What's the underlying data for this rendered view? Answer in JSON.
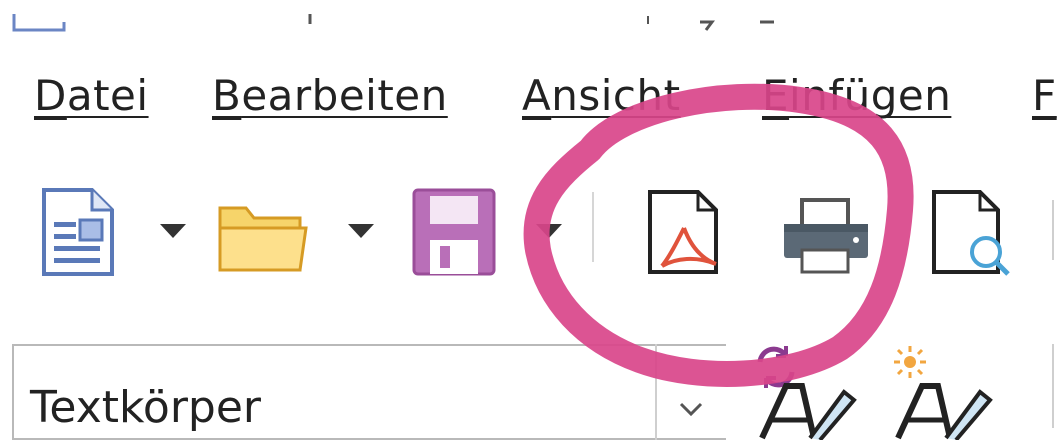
{
  "menubar": {
    "items": [
      {
        "label": "Datei",
        "accesskey": "D"
      },
      {
        "label": "Bearbeiten",
        "accesskey": "B"
      },
      {
        "label": "Ansicht",
        "accesskey": "A"
      },
      {
        "label": "Einfügen",
        "accesskey": "E"
      },
      {
        "label": "F",
        "accesskey": "F"
      }
    ]
  },
  "toolbar": {
    "buttons": [
      {
        "icon": "new-document-icon"
      },
      {
        "icon": "open-folder-icon"
      },
      {
        "icon": "save-icon"
      },
      {
        "icon": "export-pdf-icon"
      },
      {
        "icon": "print-icon"
      },
      {
        "icon": "print-preview-icon"
      }
    ]
  },
  "formatbar": {
    "paragraph_style": "Textkörper",
    "icons": [
      "update-style-icon",
      "new-style-icon"
    ]
  },
  "annotation": {
    "color": "#d9458a"
  }
}
